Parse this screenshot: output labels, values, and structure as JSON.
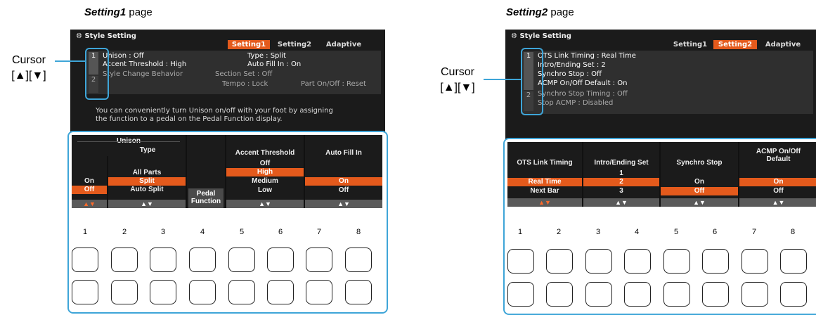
{
  "headings": {
    "left": {
      "bold": "Setting1",
      "rest": " page"
    },
    "right": {
      "bold": "Setting2",
      "rest": " page"
    }
  },
  "cursor": {
    "line1": "Cursor",
    "line2": "[▲][▼]"
  },
  "screen_title": "Style Setting",
  "tabs": [
    "Setting1",
    "Setting2",
    "Adaptive"
  ],
  "left": {
    "row1_num": "1",
    "row2_num": "2",
    "unison": "Unison : Off",
    "type": "Type : Split",
    "accent": "Accent Threshold : High",
    "autofill": "Auto Fill In : On",
    "change": "Style Change Behavior",
    "section": "Section Set : Off",
    "tempo": "Tempo : Lock",
    "parton": "Part On/Off : Reset",
    "info1": "You can conveniently turn Unison on/off with your foot by assigning",
    "info2": "the function to a pedal on the Pedal Function display.",
    "unison_group": "Unison",
    "col_type": "Type",
    "col_accent": "Accent Threshold",
    "col_autofill": "Auto Fill In",
    "unison_opts": [
      "On",
      "Off"
    ],
    "type_opts": [
      "All Parts",
      "Split",
      "Auto Split"
    ],
    "accent_opts": [
      "Off",
      "High",
      "Medium",
      "Low"
    ],
    "autofill_opts": [
      "On",
      "Off"
    ],
    "pedal1": "Pedal",
    "pedal2": "Function",
    "arrows": "▲▼"
  },
  "right": {
    "row1_num": "1",
    "row2_num": "2",
    "ots": "OTS Link Timing : Real Time",
    "intro": "Intro/Ending Set : 2",
    "synchro": "Synchro Stop : Off",
    "acmp": "ACMP On/Off Default : On",
    "synchro_timing": "Synchro Stop Timing : Off",
    "stop_acmp": "Stop ACMP : Disabled",
    "col_ots": "OTS Link Timing",
    "col_intro": "Intro/Ending Set",
    "col_synchro": "Synchro Stop",
    "col_acmp1": "ACMP On/Off",
    "col_acmp2": "Default",
    "ots_opts": [
      "Real Time",
      "Next Bar"
    ],
    "intro_opts": [
      "1",
      "2",
      "3"
    ],
    "synchro_opts": [
      "On",
      "Off"
    ],
    "acmp_opts": [
      "On",
      "Off"
    ],
    "arrows": "▲▼"
  },
  "buttons": [
    "1",
    "2",
    "3",
    "4",
    "5",
    "6",
    "7",
    "8"
  ],
  "colors": {
    "accent": "#e45a1c",
    "cursor": "#3ea5d8",
    "screen": "#1b1b1b"
  }
}
